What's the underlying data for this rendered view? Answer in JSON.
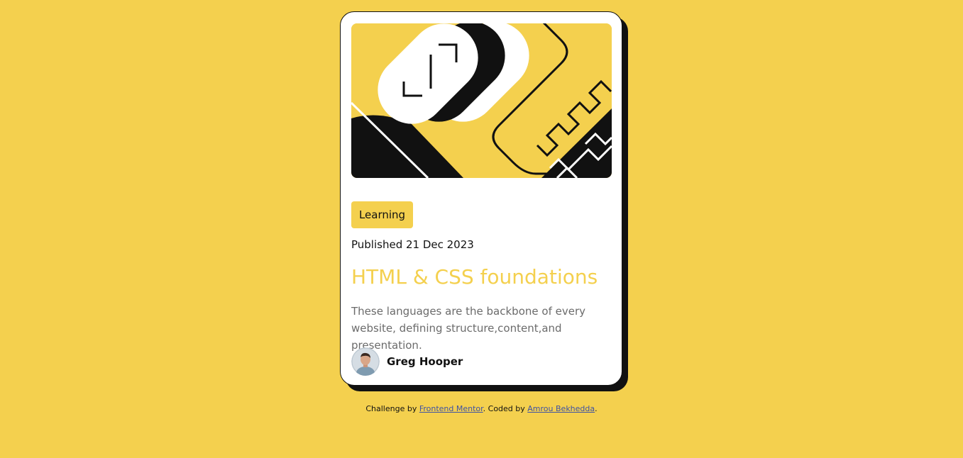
{
  "card": {
    "tag": "Learning",
    "published": "Published 21 Dec 2023",
    "title": "HTML & CSS foundations",
    "description": "These languages are the backbone of every website, defining structure,content,and presentation.",
    "author": "Greg Hooper"
  },
  "attribution": {
    "prefix": "Challenge by ",
    "link1": "Frontend Mentor",
    "middle": ". Coded by ",
    "link2": "Amrou Bekhedda",
    "suffix": "."
  },
  "colors": {
    "background": "#f4d04e",
    "card": "#ffffff",
    "text": "#111111",
    "muted": "#6b6b6b",
    "accent": "#f4d04e"
  },
  "icons": {
    "hero": "abstract-illustration",
    "avatar": "author-avatar-photo"
  }
}
